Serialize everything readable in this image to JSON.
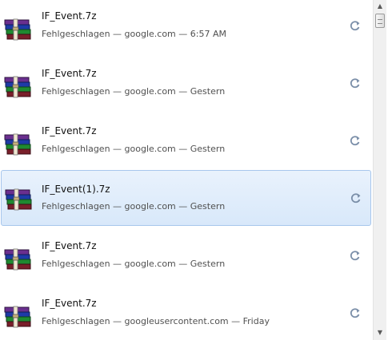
{
  "downloads": [
    {
      "filename": "IF_Event.7z",
      "status": "Fehlgeschlagen — google.com — 6:57 AM",
      "icon": "winrar-archive-icon",
      "selected": false
    },
    {
      "filename": "IF_Event.7z",
      "status": "Fehlgeschlagen — google.com — Gestern",
      "icon": "winrar-archive-icon",
      "selected": false
    },
    {
      "filename": "IF_Event.7z",
      "status": "Fehlgeschlagen — google.com — Gestern",
      "icon": "winrar-archive-icon",
      "selected": false
    },
    {
      "filename": "IF_Event(1).7z",
      "status": "Fehlgeschlagen — google.com — Gestern",
      "icon": "winrar-archive-icon",
      "selected": true
    },
    {
      "filename": "IF_Event.7z",
      "status": "Fehlgeschlagen — google.com — Gestern",
      "icon": "winrar-archive-icon",
      "selected": false
    },
    {
      "filename": "IF_Event.7z",
      "status": "Fehlgeschlagen — googleusercontent.com — Friday",
      "icon": "winrar-archive-icon",
      "selected": false
    }
  ],
  "actions": {
    "retry_icon": "retry-icon"
  },
  "scrollbar": {
    "up_arrow": "▲",
    "down_arrow": "▼"
  },
  "colors": {
    "selected_background": "#d8e8fa",
    "selected_border": "#a7c6ec",
    "status_text": "#505050",
    "retry_icon": "#7a8ea8"
  }
}
